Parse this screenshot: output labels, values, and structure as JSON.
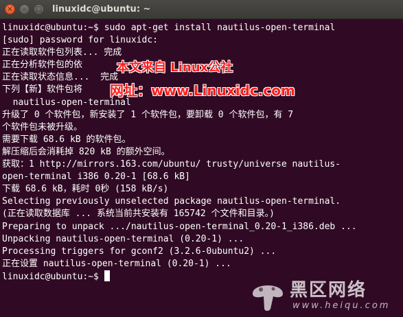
{
  "window": {
    "title": "linuxidc@ubuntu: ~",
    "close_glyph": "×",
    "min_glyph": "–",
    "max_glyph": "□"
  },
  "terminal": {
    "lines": [
      "linuxidc@ubuntu:~$ sudo apt-get install nautilus-open-terminal",
      "[sudo] password for linuxidc:",
      "正在读取软件包列表... 完成",
      "正在分析软件包的依",
      "正在读取状态信息...  完成",
      "下列【新】软件包将",
      "  nautilus-open-terminal",
      "升级了 0 个软件包，新安装了 1 个软件包，要卸载 0 个软件包，有 7",
      "个软件包未被升级。",
      "需要下载 68.6 kB 的软件包。",
      "解压缩后会消耗掉 820 kB 的额外空间。",
      "获取：1 http://mirrors.163.com/ubuntu/ trusty/universe nautilus-",
      "open-terminal i386 0.20-1 [68.6 kB]",
      "下载 68.6 kB，耗时 0秒 (158 kB/s)",
      "Selecting previously unselected package nautilus-open-terminal.",
      "(正在读取数据库 ... 系统当前共安装有 165742 个文件和目录。)",
      "Preparing to unpack .../nautilus-open-terminal_0.20-1_i386.deb ...",
      "Unpacking nautilus-open-terminal (0.20-1) ...",
      "Processing triggers for gconf2 (3.2.6-0ubuntu2) ...",
      "正在设置 nautilus-open-terminal (0.20-1) ..."
    ],
    "prompt": "linuxidc@ubuntu:~$ "
  },
  "watermark": {
    "line1": "本文来自 Linux公社",
    "line2": "网址：www.Linuxidc.com"
  },
  "logo": {
    "text": "黑区网络",
    "url": "www.heiqu.com"
  },
  "colors": {
    "terminal_bg": "#300a24",
    "terminal_fg": "#ffffff",
    "titlebar": "#3c3b37",
    "close_button": "#e9541f",
    "watermark_red": "#ff1e1e"
  }
}
